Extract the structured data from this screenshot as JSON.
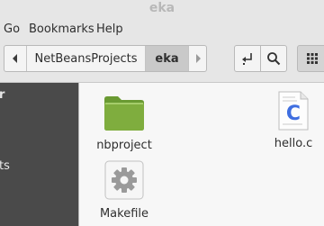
{
  "window": {
    "title": "eka"
  },
  "menu": {
    "items": [
      "Go",
      "Bookmarks",
      "Help"
    ]
  },
  "pathbar": {
    "back_icon": "chevron-left-icon",
    "forward_icon": "chevron-right-icon",
    "segments": [
      "NetBeansProjects",
      "eka"
    ],
    "current": "eka"
  },
  "toolbar": {
    "icons": [
      "open-location-icon",
      "search-icon",
      "grid-view-icon"
    ]
  },
  "sidebar": {
    "heading_fragment": "r",
    "item_fragment": "ts"
  },
  "files": [
    {
      "name": "nbproject",
      "icon": "folder-icon"
    },
    {
      "name": "hello.c",
      "icon": "c-source-file-icon",
      "glyph": "C"
    },
    {
      "name": "Makefile",
      "icon": "makefile-gear-icon"
    }
  ],
  "colors": {
    "folder": "#7fad3e",
    "c_glyph": "#3f6ee0",
    "sidebar_bg": "#4a4a4a",
    "selected_segment": "#c9c9c9"
  }
}
